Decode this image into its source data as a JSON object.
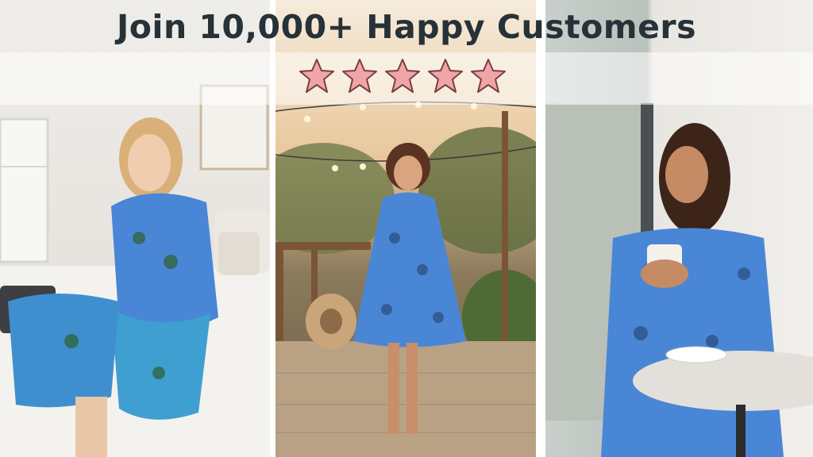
{
  "headline": "Join 10,000+ Happy Customers",
  "rating": {
    "stars": 5,
    "max": 5
  },
  "colors": {
    "headline_text": "#263238",
    "star_fill": "#f0a6a6",
    "star_stroke": "#7a3f3f",
    "dress_blue": "#4a86d6",
    "dress_teal": "#3fb3c8"
  },
  "icons": [
    "star-icon"
  ]
}
